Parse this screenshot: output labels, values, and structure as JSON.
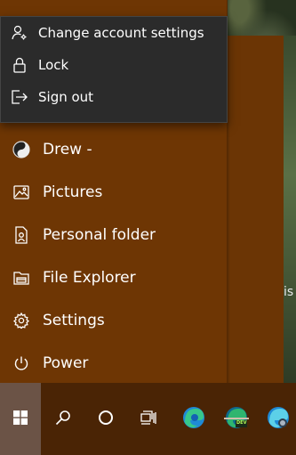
{
  "account_menu": {
    "items": [
      {
        "label": "Change account settings",
        "icon": "account-settings-icon"
      },
      {
        "label": "Lock",
        "icon": "lock-icon"
      },
      {
        "label": "Sign out",
        "icon": "sign-out-icon"
      }
    ]
  },
  "start_nav": {
    "user": {
      "label": "Drew -",
      "icon": "user-avatar-icon"
    },
    "items": [
      {
        "label": "Pictures",
        "icon": "pictures-icon"
      },
      {
        "label": "Personal folder",
        "icon": "personal-folder-icon"
      },
      {
        "label": "File Explorer",
        "icon": "file-explorer-icon"
      },
      {
        "label": "Settings",
        "icon": "gear-icon"
      },
      {
        "label": "Power",
        "icon": "power-icon"
      }
    ]
  },
  "background": {
    "partial_text": "is"
  },
  "taskbar": {
    "buttons": [
      "windows-start-icon",
      "search-icon",
      "cortana-icon",
      "task-view-icon"
    ],
    "apps": [
      {
        "name": "edge-icon",
        "badge": ""
      },
      {
        "name": "edge-dev-icon",
        "badge": "DEV"
      },
      {
        "name": "edge-canary-icon",
        "badge": ""
      }
    ]
  },
  "colors": {
    "start_panel": "#6e3604",
    "flyout": "#2b2b2b",
    "taskbar": "#4a2405"
  }
}
